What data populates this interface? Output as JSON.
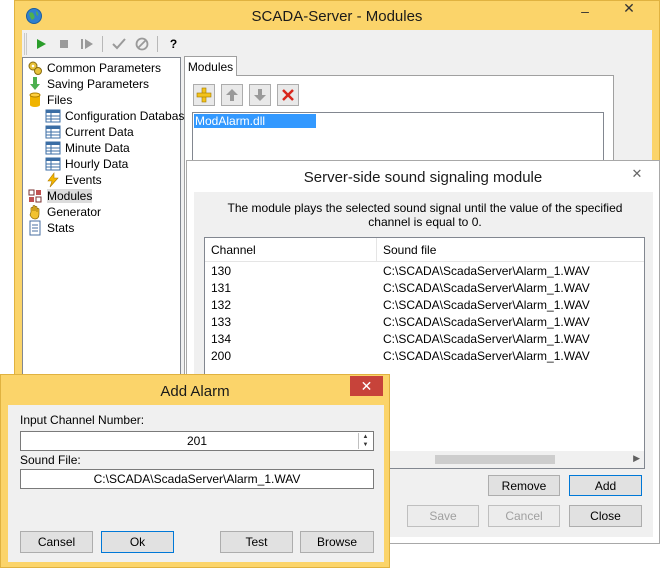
{
  "main_window": {
    "title": "SCADA-Server - Modules",
    "minimize": "–",
    "close": "✕"
  },
  "toolbar": {
    "items": [
      {
        "name": "start-icon",
        "glyph": "▶",
        "color": "#2a9d2a"
      },
      {
        "name": "stop-icon",
        "glyph": "■",
        "color": "#9a9a9a"
      },
      {
        "name": "restart-icon",
        "glyph": "▷",
        "color": "#9a9a9a"
      },
      {
        "name": "apply-icon",
        "glyph": "✔",
        "color": "#9a9a9a"
      },
      {
        "name": "cancel-icon",
        "glyph": "⊘",
        "color": "#9a9a9a"
      },
      {
        "name": "help-icon",
        "glyph": "?",
        "color": "#000000"
      }
    ]
  },
  "tree": {
    "items": [
      {
        "label": "Common Parameters",
        "icon": "gears-icon"
      },
      {
        "label": "Saving Parameters",
        "icon": "save-arrow-icon"
      },
      {
        "label": "Files",
        "icon": "cylinder-icon"
      },
      {
        "label": "Configuration Database",
        "icon": "table-icon"
      },
      {
        "label": "Current Data",
        "icon": "table-icon"
      },
      {
        "label": "Minute Data",
        "icon": "table-icon"
      },
      {
        "label": "Hourly Data",
        "icon": "table-icon"
      },
      {
        "label": "Events",
        "icon": "lightning-icon"
      },
      {
        "label": "Modules",
        "icon": "modules-icon"
      },
      {
        "label": "Generator",
        "icon": "hand-icon"
      },
      {
        "label": "Stats",
        "icon": "document-icon"
      }
    ]
  },
  "tabs": {
    "modules": "Modules"
  },
  "module_list": {
    "items": [
      "ModAlarm.dll"
    ]
  },
  "module_dialog": {
    "title": "Server-side sound signaling module",
    "close": "✕",
    "description": "The module plays the selected sound signal until the value of the specified channel is equal to 0.",
    "columns": [
      "Channel",
      "Sound file"
    ],
    "rows": [
      {
        "channel": "130",
        "file": "C:\\SCADA\\ScadaServer\\Alarm_1.WAV"
      },
      {
        "channel": "131",
        "file": "C:\\SCADA\\ScadaServer\\Alarm_1.WAV"
      },
      {
        "channel": "132",
        "file": "C:\\SCADA\\ScadaServer\\Alarm_1.WAV"
      },
      {
        "channel": "133",
        "file": "C:\\SCADA\\ScadaServer\\Alarm_1.WAV"
      },
      {
        "channel": "134",
        "file": "C:\\SCADA\\ScadaServer\\Alarm_1.WAV"
      },
      {
        "channel": "200",
        "file": "C:\\SCADA\\ScadaServer\\Alarm_1.WAV"
      }
    ],
    "buttons": {
      "remove": "Remove",
      "add": "Add",
      "save": "Save",
      "cancel": "Cancel",
      "close": "Close"
    }
  },
  "add_dialog": {
    "title": "Add Alarm",
    "close": "✕",
    "channel_label": "Input Channel Number:",
    "channel_value": "201",
    "sound_label": "Sound File:",
    "sound_value": "C:\\SCADA\\ScadaServer\\Alarm_1.WAV",
    "buttons": {
      "cancel": "Cansel",
      "ok": "Ok",
      "test": "Test",
      "browse": "Browse"
    }
  }
}
